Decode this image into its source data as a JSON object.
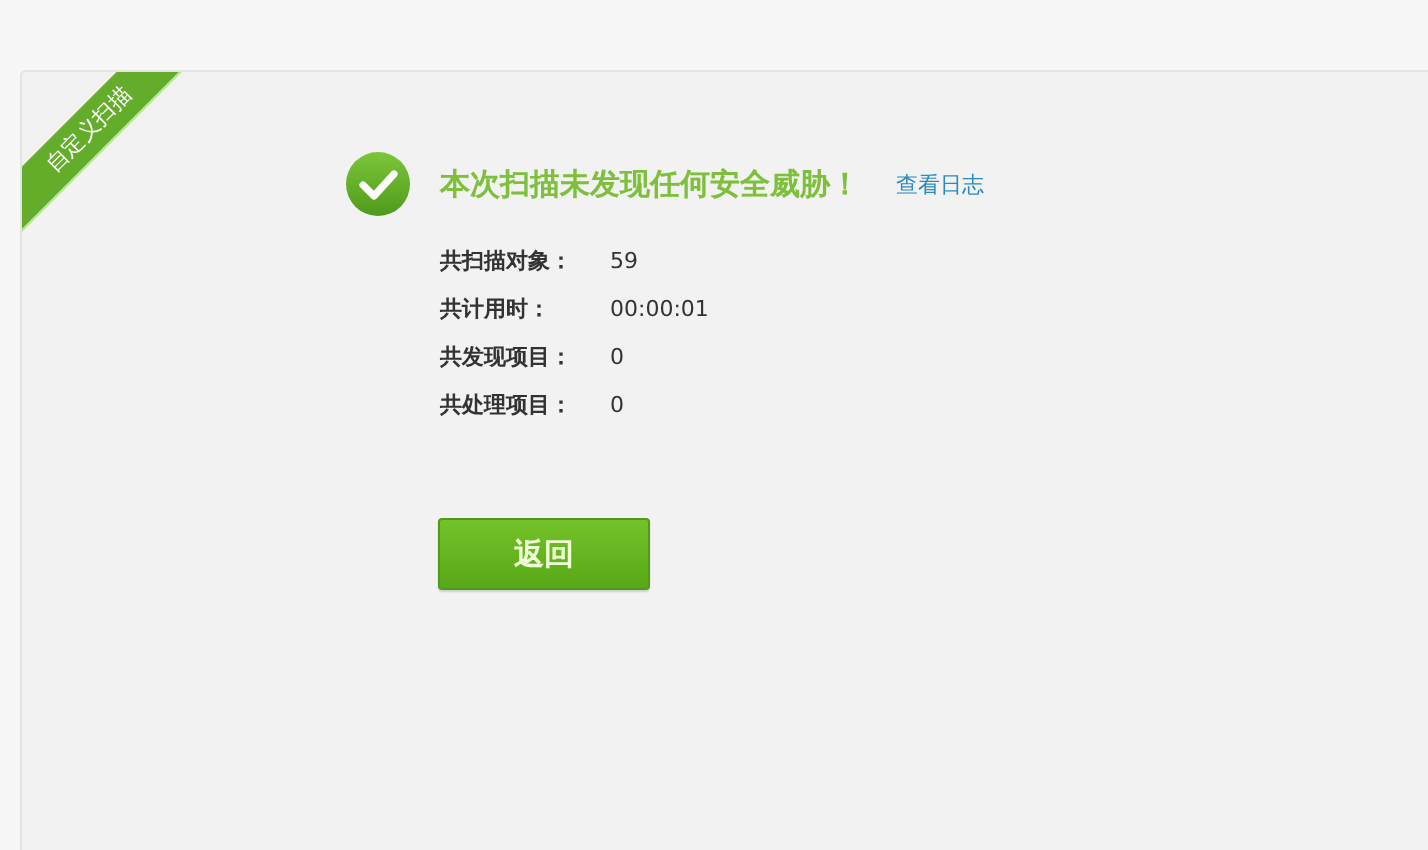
{
  "ribbon": {
    "label": "自定义扫描"
  },
  "result": {
    "title": "本次扫描未发现任何安全威胁！",
    "log_link": "查看日志"
  },
  "stats": [
    {
      "label": "共扫描对象：",
      "value": "59"
    },
    {
      "label": "共计用时：",
      "value": "00:00:01"
    },
    {
      "label": "共发现项目：",
      "value": "0"
    },
    {
      "label": "共处理项目：",
      "value": "0"
    }
  ],
  "buttons": [
    "返回"
  ]
}
